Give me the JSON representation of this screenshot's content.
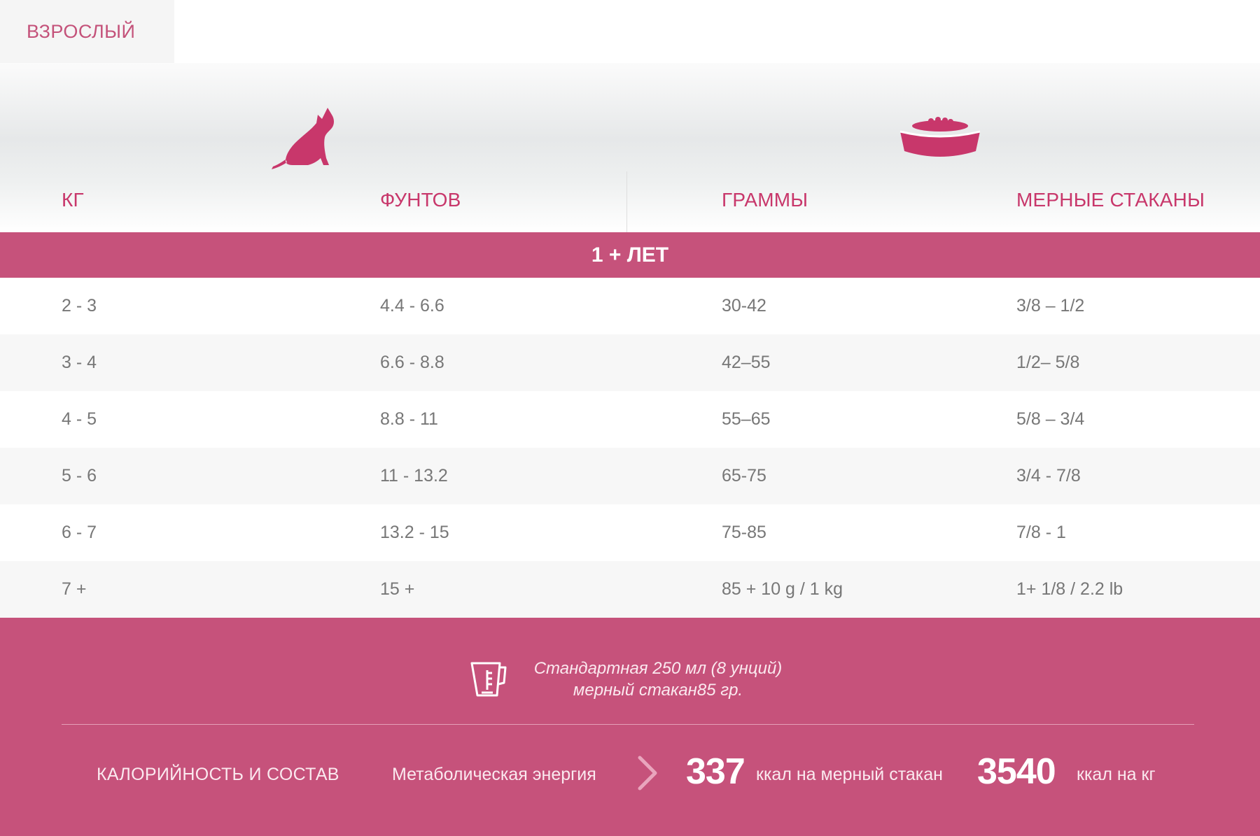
{
  "tab": {
    "label": "ВЗРОСЛЫЙ"
  },
  "icons": {
    "cat": "cat-silhouette-icon",
    "bowl": "food-bowl-icon",
    "cup": "measuring-cup-icon",
    "arrow": "chevron-right-icon"
  },
  "colors": {
    "accent": "#c6527b",
    "heading": "#c8376b",
    "text": "#777777",
    "zebra": "#f7f7f7"
  },
  "columns": [
    "КГ",
    "ФУНТОВ",
    "ГРАММЫ",
    "МЕРНЫЕ СТАКАНЫ"
  ],
  "band": {
    "label": "1 + ЛЕТ"
  },
  "rows": [
    [
      "2 - 3",
      "4.4 - 6.6",
      "30-42",
      "3/8 – 1/2"
    ],
    [
      "3 - 4",
      "6.6 - 8.8",
      "42–55",
      "1/2– 5/8"
    ],
    [
      "4 - 5",
      "8.8 - 11",
      "55–65",
      "5/8 – 3/4"
    ],
    [
      "5 - 6",
      "11 - 13.2",
      "65-75",
      "3/4 - 7/8"
    ],
    [
      "6 - 7",
      "13.2 - 15",
      "75-85",
      "7/8 - 1"
    ],
    [
      "7 +",
      "15 +",
      "85 + 10 g / 1 kg",
      "1+ 1/8 / 2.2 lb"
    ]
  ],
  "footer": {
    "cup_line1": "Стандартная 250 мл (8 унций)",
    "cup_line2": "мерный стакан85 гр.",
    "calories_title": "КАЛОРИЙНОСТЬ И СОСТАВ",
    "energy_label": "Метаболическая энергия",
    "per_cup_value": "337",
    "per_cup_unit": "ккал на мерный стакан",
    "per_kg_value": "3540",
    "per_kg_unit": "ккал на кг"
  }
}
